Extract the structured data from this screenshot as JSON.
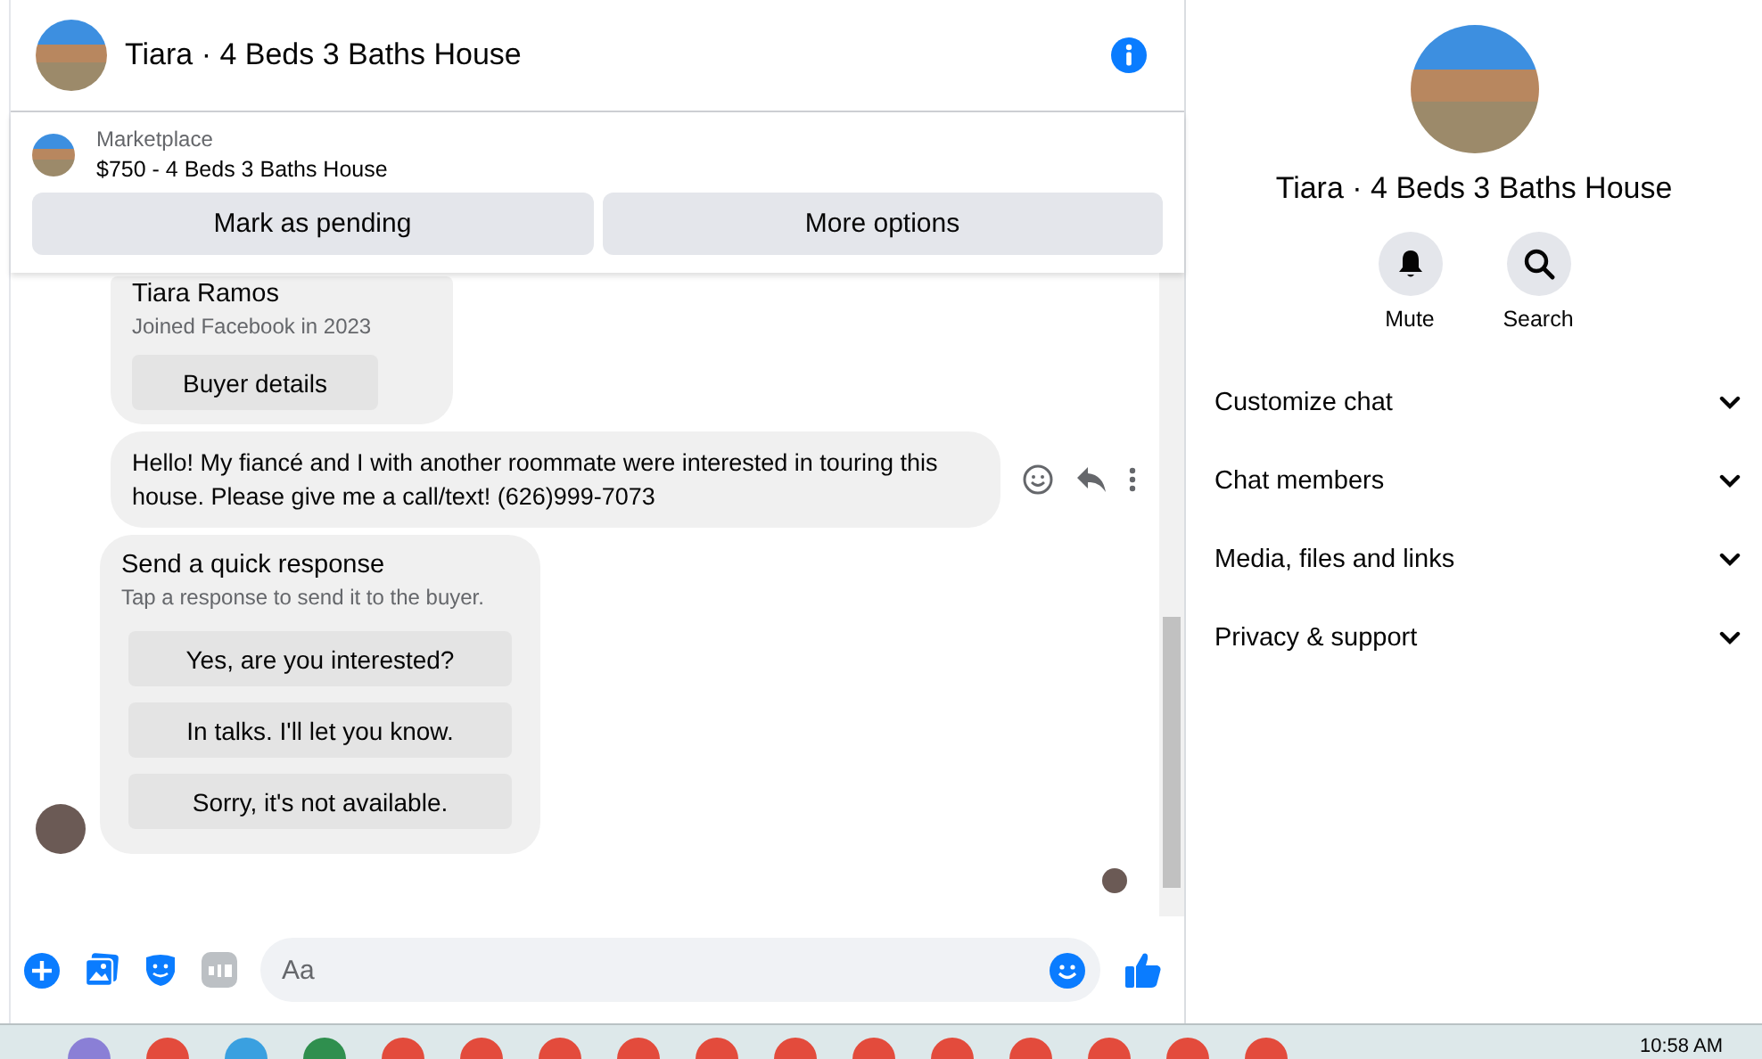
{
  "header": {
    "title": "Tiara · 4 Beds 3 Baths House"
  },
  "listing": {
    "source": "Marketplace",
    "title": "$750 - 4 Beds 3 Baths House",
    "buttons": [
      "Mark as pending",
      "More options"
    ]
  },
  "buyer": {
    "name": "Tiara Ramos",
    "joined": "Joined Facebook in 2023",
    "button": "Buyer details"
  },
  "message": {
    "text": "Hello! My fiancé and I with another roommate were interested in touring this house. Please give me a call/text! (626)999-7073"
  },
  "quick_response": {
    "title": "Send a quick response",
    "subtitle": "Tap a response to send it to the buyer.",
    "options": [
      "Yes, are you interested?",
      "In talks. I'll let you know.",
      "Sorry, it's not available."
    ]
  },
  "composer": {
    "placeholder": "Aa"
  },
  "details": {
    "title": "Tiara · 4 Beds 3 Baths House",
    "actions": [
      {
        "kind": "mute",
        "label": "Mute"
      },
      {
        "kind": "search",
        "label": "Search"
      }
    ],
    "sections": [
      {
        "label": "Customize chat",
        "expanded": false
      },
      {
        "label": "Chat members",
        "expanded": false
      },
      {
        "label": "Media, files and links",
        "expanded": false
      },
      {
        "label": "Privacy & support",
        "expanded": false
      }
    ]
  },
  "taskbar": {
    "time": "10:58 AM"
  }
}
